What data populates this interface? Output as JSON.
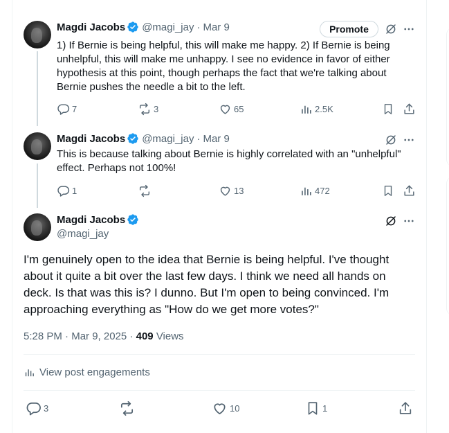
{
  "tweet1": {
    "author_name": "Magdi Jacobs",
    "handle": "@magi_jay",
    "separator": "·",
    "date": "Mar 9",
    "promote_label": "Promote",
    "lines": [
      "1) If Bernie is being helpful, this will make me happy. 2) If Bernie is being",
      "unhelpful, this will make me unhappy. I see no evidence in favor of either",
      "hypothesis at this point, though perhaps the fact that we're talking about",
      "Bernie pushes the needle a bit to the left."
    ],
    "replies": "7",
    "reposts": "3",
    "likes": "65",
    "views": "2.5K"
  },
  "tweet2": {
    "author_name": "Magdi Jacobs",
    "handle": "@magi_jay",
    "separator": "·",
    "date": "Mar 9",
    "lines": [
      "This is because talking about Bernie is highly correlated with an \"unhelpful\"",
      "effect. Perhaps not 100%!"
    ],
    "replies": "1",
    "likes": "13",
    "views": "472"
  },
  "main": {
    "author_name": "Magdi Jacobs",
    "handle": "@magi_jay",
    "lines": [
      "I'm genuinely open to the idea that Bernie is being helpful. I've thought",
      "about it quite a bit over the last few days. I think we need all hands on",
      "deck. Is that was this is? I dunno. But I'm open to being convinced. I'm",
      "approaching everything as \"How do we get more votes?\""
    ],
    "time": "5:28 PM",
    "date": "Mar 9, 2025",
    "views_count": "409",
    "views_label": "Views",
    "engagements_label": "View post engagements",
    "replies": "3",
    "likes": "10",
    "bookmarks": "1"
  },
  "icons": {
    "verified": "verified-badge-icon",
    "grok": "grok-icon",
    "more": "more-icon",
    "reply": "reply-icon",
    "repost": "repost-icon",
    "like": "like-icon",
    "views": "views-icon",
    "bookmark": "bookmark-icon",
    "share": "share-icon"
  },
  "colors": {
    "verified": "#1d9bf0",
    "text": "#0f1419",
    "secondary": "#536471",
    "border": "#eff3f4"
  }
}
